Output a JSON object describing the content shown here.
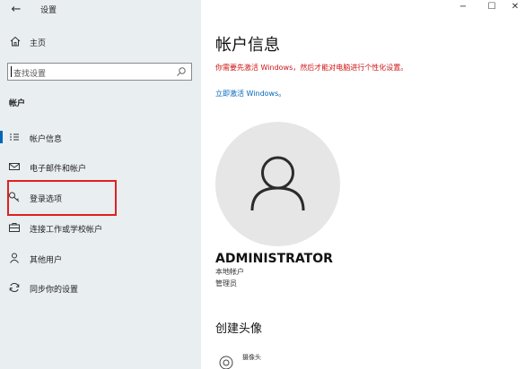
{
  "window": {
    "title": "设置",
    "back_glyph": "←",
    "minimize_glyph": "−",
    "maximize_glyph": "☐",
    "close_glyph": "✕"
  },
  "sidebar": {
    "home_label": "主页",
    "search_placeholder": "查找设置",
    "section_title": "帐户",
    "items": [
      {
        "label": "帐户信息",
        "icon": "account-info-icon",
        "active": true
      },
      {
        "label": "电子邮件和帐户",
        "icon": "mail-icon",
        "active": false
      },
      {
        "label": "登录选项",
        "icon": "key-icon",
        "active": false,
        "highlighted": true
      },
      {
        "label": "连接工作或学校帐户",
        "icon": "briefcase-icon",
        "active": false
      },
      {
        "label": "其他用户",
        "icon": "person-icon",
        "active": false
      },
      {
        "label": "同步你的设置",
        "icon": "sync-icon",
        "active": false
      }
    ]
  },
  "main": {
    "page_title": "帐户信息",
    "warning": "你需要先激活 Windows，然后才能对电脑进行个性化设置。",
    "activate_link": "立即激活 Windows。",
    "user_name": "ADMINISTRATOR",
    "account_type": "本地帐户",
    "account_role": "管理员",
    "create_avatar_title": "创建头像",
    "camera_label": "摄像头"
  },
  "colors": {
    "sidebar_bg": "#e9eef1",
    "accent": "#0067b8",
    "warning": "#d01010",
    "highlight_box": "#e02020",
    "avatar_bg": "#e6e6e6"
  }
}
